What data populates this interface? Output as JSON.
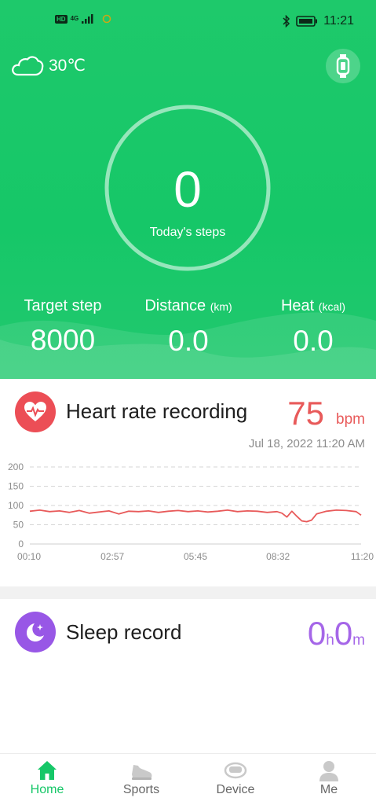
{
  "status_bar": {
    "hd": "HD",
    "network": "4G",
    "time": "11:21"
  },
  "weather": {
    "temperature": "30℃",
    "icon": "cloud-icon"
  },
  "device_icon": "smart-band-icon",
  "steps": {
    "value": "0",
    "label": "Today's steps",
    "progress_fraction": 0
  },
  "stats": {
    "target": {
      "label": "Target step",
      "unit": "",
      "value": "8000"
    },
    "distance": {
      "label": "Distance",
      "unit": "(km)",
      "value": "0.0"
    },
    "heat": {
      "label": "Heat",
      "unit": "(kcal)",
      "value": "0.0"
    }
  },
  "heart_rate": {
    "title": "Heart rate recording",
    "value": "75",
    "unit": "bpm",
    "timestamp": "Jul 18, 2022 11:20 AM",
    "icon": "heart-pulse-icon"
  },
  "chart_data": {
    "type": "line",
    "title": "",
    "xlabel": "",
    "ylabel": "",
    "ylim": [
      0,
      200
    ],
    "yticks": [
      "0",
      "50",
      "100",
      "150",
      "200"
    ],
    "x_tick_labels": [
      "00:10",
      "02:57",
      "05:45",
      "08:32",
      "11:20"
    ],
    "grid": "dashed horizontal",
    "series": [
      {
        "color": "#e85a5a",
        "x": [
          "00:10",
          "00:30",
          "00:50",
          "01:10",
          "01:30",
          "01:50",
          "02:10",
          "02:30",
          "02:50",
          "03:10",
          "03:30",
          "03:50",
          "04:10",
          "04:30",
          "04:50",
          "05:10",
          "05:30",
          "05:50",
          "06:10",
          "06:30",
          "06:50",
          "07:10",
          "07:30",
          "07:50",
          "08:10",
          "08:30",
          "08:40",
          "08:50",
          "09:00",
          "09:10",
          "09:20",
          "09:30",
          "09:40",
          "09:50",
          "10:10",
          "10:30",
          "10:50",
          "11:10",
          "11:20"
        ],
        "y": [
          85,
          88,
          84,
          86,
          82,
          87,
          80,
          83,
          86,
          78,
          85,
          84,
          86,
          82,
          85,
          87,
          84,
          86,
          83,
          85,
          88,
          84,
          86,
          85,
          82,
          84,
          80,
          70,
          85,
          72,
          60,
          58,
          62,
          78,
          85,
          88,
          87,
          84,
          75
        ]
      }
    ]
  },
  "sleep": {
    "title": "Sleep record",
    "hours": "0",
    "hours_unit": "h",
    "minutes": "0",
    "minutes_unit": "m",
    "icon": "moon-star-icon"
  },
  "tabs": [
    {
      "label": "Home",
      "icon": "home-icon",
      "active": true
    },
    {
      "label": "Sports",
      "icon": "sneaker-icon",
      "active": false
    },
    {
      "label": "Device",
      "icon": "band-device-icon",
      "active": false
    },
    {
      "label": "Me",
      "icon": "user-icon",
      "active": false
    }
  ],
  "colors": {
    "brand_green": "#16c768",
    "heart_red": "#e85a5a",
    "sleep_purple": "#a566e8"
  }
}
